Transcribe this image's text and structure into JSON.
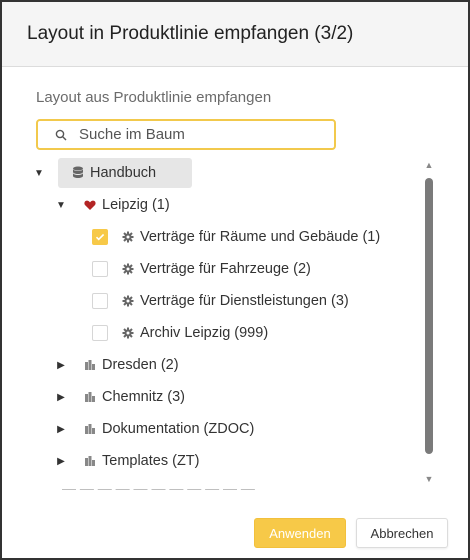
{
  "dialog": {
    "title": "Layout in Produktlinie empfangen (3/2)",
    "subtitle": "Layout aus Produktlinie empfangen"
  },
  "search": {
    "placeholder": "Suche im Baum"
  },
  "tree": {
    "root": {
      "label": "Handbuch",
      "icon": "database-icon",
      "expanded": true
    },
    "leipzig": {
      "label": "Leipzig (1)",
      "icon": "heart-icon",
      "expanded": true
    },
    "leipzig_children": [
      {
        "label": "Verträge für Räume und Gebäude (1)",
        "checked": true,
        "icon": "gear-icon"
      },
      {
        "label": "Verträge für Fahrzeuge (2)",
        "checked": false,
        "icon": "gear-icon"
      },
      {
        "label": "Verträge für Dienstleistungen (3)",
        "checked": false,
        "icon": "gear-icon"
      },
      {
        "label": "Archiv Leipzig (999)",
        "checked": false,
        "icon": "gear-icon"
      }
    ],
    "siblings": [
      {
        "label": "Dresden (2)",
        "icon": "building-icon",
        "expanded": false
      },
      {
        "label": "Chemnitz (3)",
        "icon": "building-icon",
        "expanded": false
      },
      {
        "label": "Dokumentation (ZDOC)",
        "icon": "building-icon",
        "expanded": false
      },
      {
        "label": "Templates (ZT)",
        "icon": "building-icon",
        "expanded": false
      }
    ]
  },
  "buttons": {
    "apply": "Anwenden",
    "cancel": "Abbrechen"
  },
  "colors": {
    "accent": "#f7c948",
    "heart": "#b32424"
  }
}
